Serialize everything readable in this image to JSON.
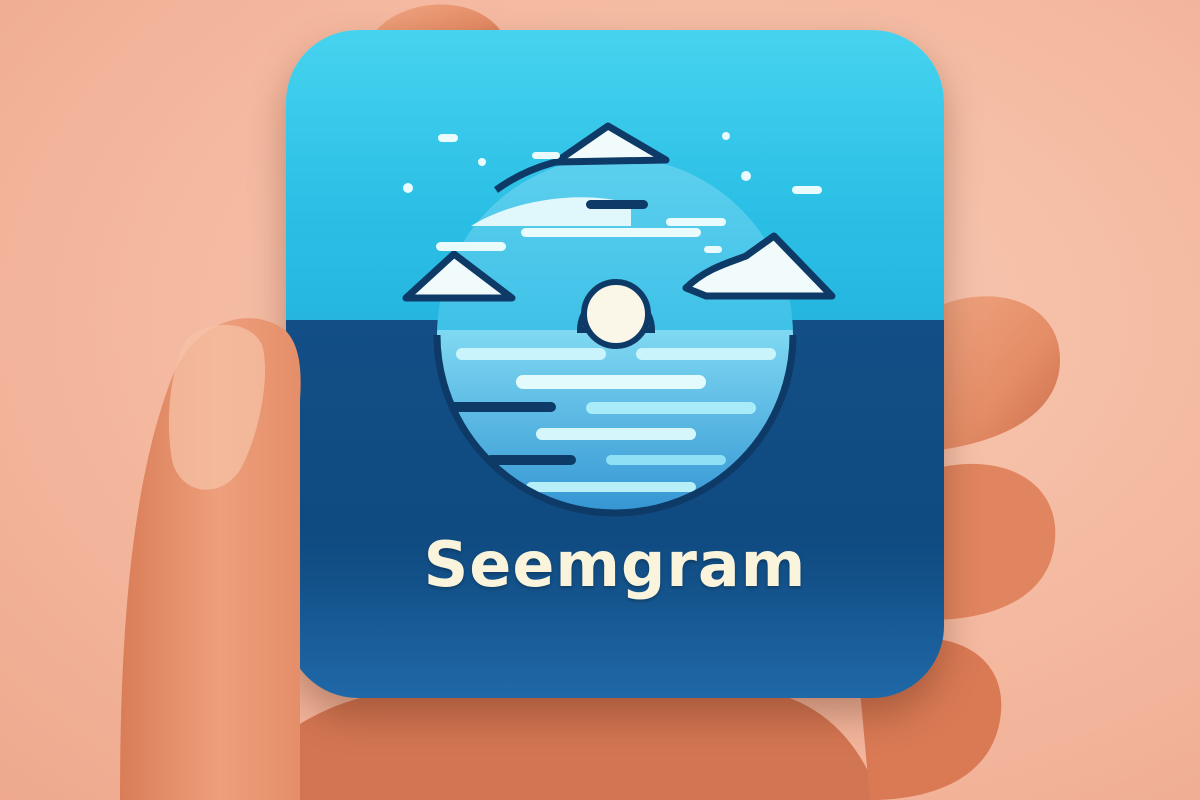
{
  "app": {
    "name": "Seemgram",
    "icon": "app-icon-sea-sunset-clouds"
  },
  "colors": {
    "background": "#f4b9a0",
    "skin": "#e9946f",
    "icon_top": "#2cc0e6",
    "icon_bottom": "#0f4a80",
    "emblem_outline": "#0d3a66",
    "water_light": "#8fe3f4",
    "water_mid": "#3aa7dc",
    "cloud": "#e9fbfd",
    "sun": "#fbf7e8",
    "label": "#fbf4dc"
  }
}
